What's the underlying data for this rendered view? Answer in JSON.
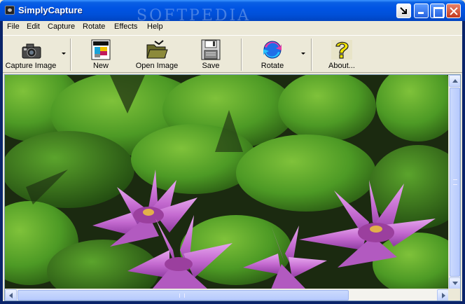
{
  "window": {
    "title": "SimplyCapture",
    "watermark": "SOFTPEDIA"
  },
  "menu": {
    "items": [
      "File",
      "Edit",
      "Capture",
      "Rotate",
      "Effects",
      "Help"
    ]
  },
  "toolbar": {
    "capture_image": "Capture Image",
    "new": "New",
    "open_image": "Open Image",
    "save": "Save",
    "rotate": "Rotate",
    "about": "About..."
  },
  "icons": {
    "app": "camera-icon",
    "capture": "camera-icon",
    "new": "new-image-icon",
    "open": "open-image-icon",
    "save": "floppy-disk-icon",
    "rotate": "rotate-arrows-icon",
    "about": "question-mark-icon"
  },
  "colors": {
    "titlebar": "#0054e3",
    "chrome": "#ece9d8",
    "leaf": "#3f8a22",
    "petal": "#c76fd0"
  }
}
